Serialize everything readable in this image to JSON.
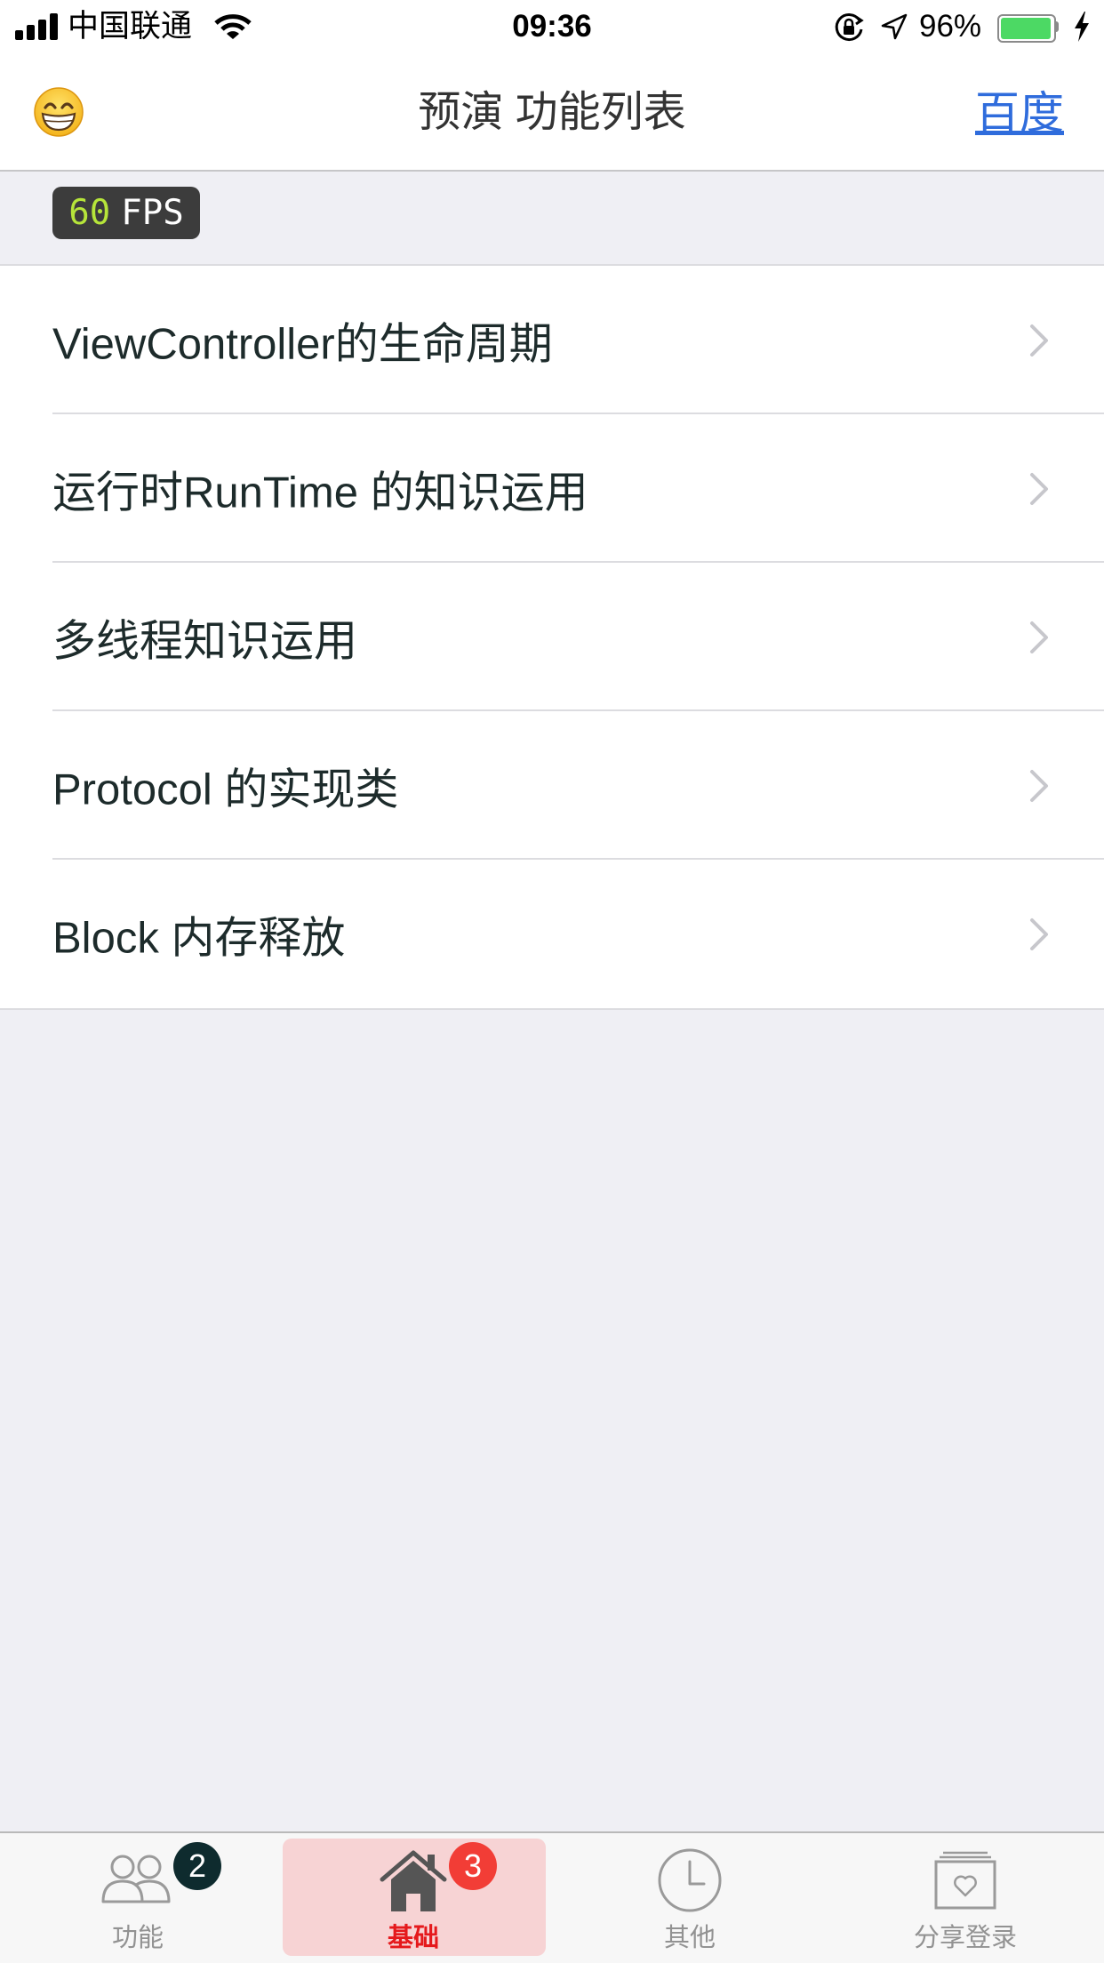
{
  "status_bar": {
    "carrier": "中国联通",
    "time": "09:36",
    "battery_text": "96%",
    "battery_fill": 0.96,
    "icons": [
      "signal-icon",
      "wifi-icon",
      "rotation-lock-icon",
      "location-icon",
      "battery-icon",
      "charging-icon"
    ]
  },
  "nav": {
    "left_icon": "grinning-face-icon",
    "title": "预演 功能列表",
    "right_link": "百度"
  },
  "fps": {
    "value": "60",
    "unit": "FPS"
  },
  "list": {
    "accessory_icon": "chevron-right-icon",
    "rows": [
      {
        "label": "ViewController的生命周期"
      },
      {
        "label": "运行时RunTime 的知识运用"
      },
      {
        "label": "多线程知识运用"
      },
      {
        "label": "Protocol 的实现类"
      },
      {
        "label": "Block 内存释放"
      }
    ]
  },
  "tabbar": {
    "items": [
      {
        "label": "功能",
        "icon": "people-icon",
        "badge": "2",
        "selected": false
      },
      {
        "label": "基础",
        "icon": "house-icon",
        "badge": "3",
        "selected": true
      },
      {
        "label": "其他",
        "icon": "clock-icon",
        "selected": false
      },
      {
        "label": "分享登录",
        "icon": "heart-card-icon",
        "selected": false
      }
    ]
  },
  "colors": {
    "link": "#2f6cdc",
    "tab_selected": "#e5191c",
    "tab_normal": "#929292",
    "selected_tab_background": "#f7d3d4",
    "badge_dark": "#0e2b2e",
    "badge_red": "#f23d36",
    "battery": "#4cd964",
    "fps_value": "#b6e53a",
    "row_text": "#1d2b2b"
  }
}
